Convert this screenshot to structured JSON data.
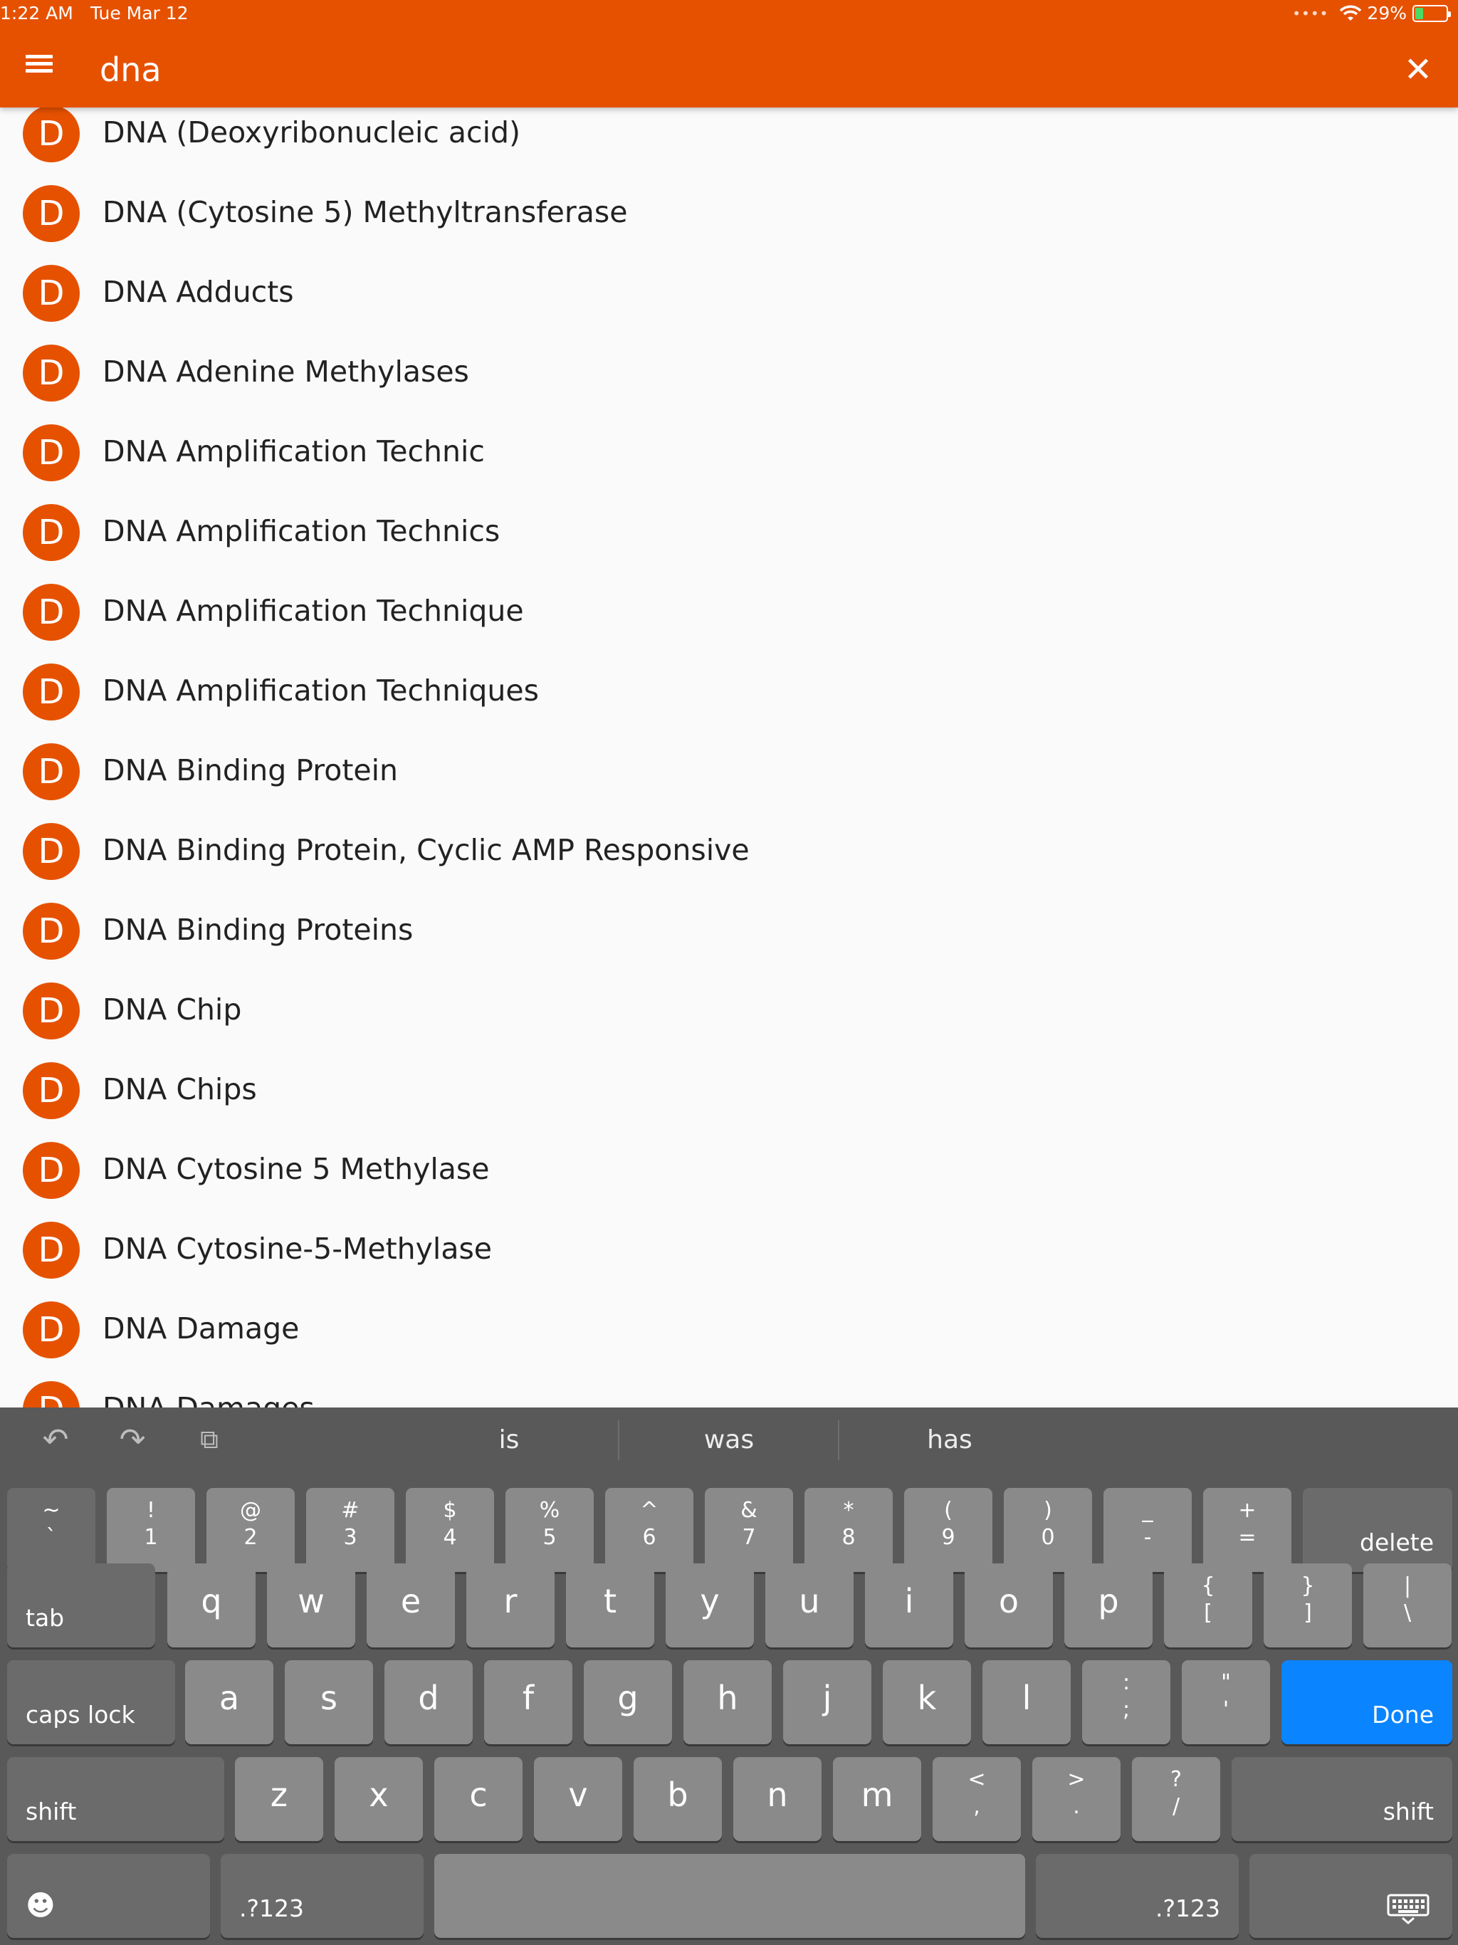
{
  "status_bar": {
    "time": "1:22 AM",
    "date": "Tue Mar 12",
    "battery": "29%"
  },
  "header": {
    "search_value": "dna",
    "menu_icon": "hamburger-menu-icon",
    "close_icon": "close-icon"
  },
  "list": {
    "items": [
      {
        "initial": "D",
        "label": "DNA (Deoxyribonucleic acid)"
      },
      {
        "initial": "D",
        "label": "DNA (Cytosine 5) Methyltransferase"
      },
      {
        "initial": "D",
        "label": "DNA Adducts"
      },
      {
        "initial": "D",
        "label": "DNA Adenine Methylases"
      },
      {
        "initial": "D",
        "label": "DNA Amplification Technic"
      },
      {
        "initial": "D",
        "label": "DNA Amplification Technics"
      },
      {
        "initial": "D",
        "label": "DNA Amplification Technique"
      },
      {
        "initial": "D",
        "label": "DNA Amplification Techniques"
      },
      {
        "initial": "D",
        "label": "DNA Binding Protein"
      },
      {
        "initial": "D",
        "label": "DNA Binding Protein, Cyclic AMP Responsive"
      },
      {
        "initial": "D",
        "label": "DNA Binding Proteins"
      },
      {
        "initial": "D",
        "label": "DNA Chip"
      },
      {
        "initial": "D",
        "label": "DNA Chips"
      },
      {
        "initial": "D",
        "label": "DNA Cytosine 5 Methylase"
      },
      {
        "initial": "D",
        "label": "DNA Cytosine-5-Methylase"
      },
      {
        "initial": "D",
        "label": "DNA Damage"
      },
      {
        "initial": "D",
        "label": "DNA Damages"
      }
    ]
  },
  "keyboard": {
    "suggestions": [
      "is",
      "was",
      "has"
    ],
    "row1": [
      {
        "top": "~",
        "bottom": "`"
      },
      {
        "top": "!",
        "bottom": "1"
      },
      {
        "top": "@",
        "bottom": "2"
      },
      {
        "top": "#",
        "bottom": "3"
      },
      {
        "top": "$",
        "bottom": "4"
      },
      {
        "top": "%",
        "bottom": "5"
      },
      {
        "top": "^",
        "bottom": "6"
      },
      {
        "top": "&",
        "bottom": "7"
      },
      {
        "top": "*",
        "bottom": "8"
      },
      {
        "top": "(",
        "bottom": "9"
      },
      {
        "top": ")",
        "bottom": "0"
      },
      {
        "top": "_",
        "bottom": "-"
      },
      {
        "top": "+",
        "bottom": "="
      }
    ],
    "delete": "delete",
    "tab": "tab",
    "row2": [
      "q",
      "w",
      "e",
      "r",
      "t",
      "y",
      "u",
      "i",
      "o",
      "p"
    ],
    "row2_syms": [
      {
        "top": "{",
        "bottom": "["
      },
      {
        "top": "}",
        "bottom": "]"
      },
      {
        "top": "|",
        "bottom": "\\"
      }
    ],
    "caps": "caps lock",
    "row3": [
      "a",
      "s",
      "d",
      "f",
      "g",
      "h",
      "j",
      "k",
      "l"
    ],
    "row3_syms": [
      {
        "top": ":",
        "bottom": ";"
      },
      {
        "top": "\"",
        "bottom": "'"
      }
    ],
    "done": "Done",
    "shift": "shift",
    "row4": [
      "z",
      "x",
      "c",
      "v",
      "b",
      "n",
      "m"
    ],
    "row4_syms": [
      {
        "top": "<",
        "bottom": ","
      },
      {
        "top": ">",
        "bottom": "."
      },
      {
        "top": "?",
        "bottom": "/"
      }
    ],
    "numbers": ".?123",
    "emoji_icon": "emoji-icon",
    "dismiss_icon": "keyboard-dismiss-icon"
  }
}
